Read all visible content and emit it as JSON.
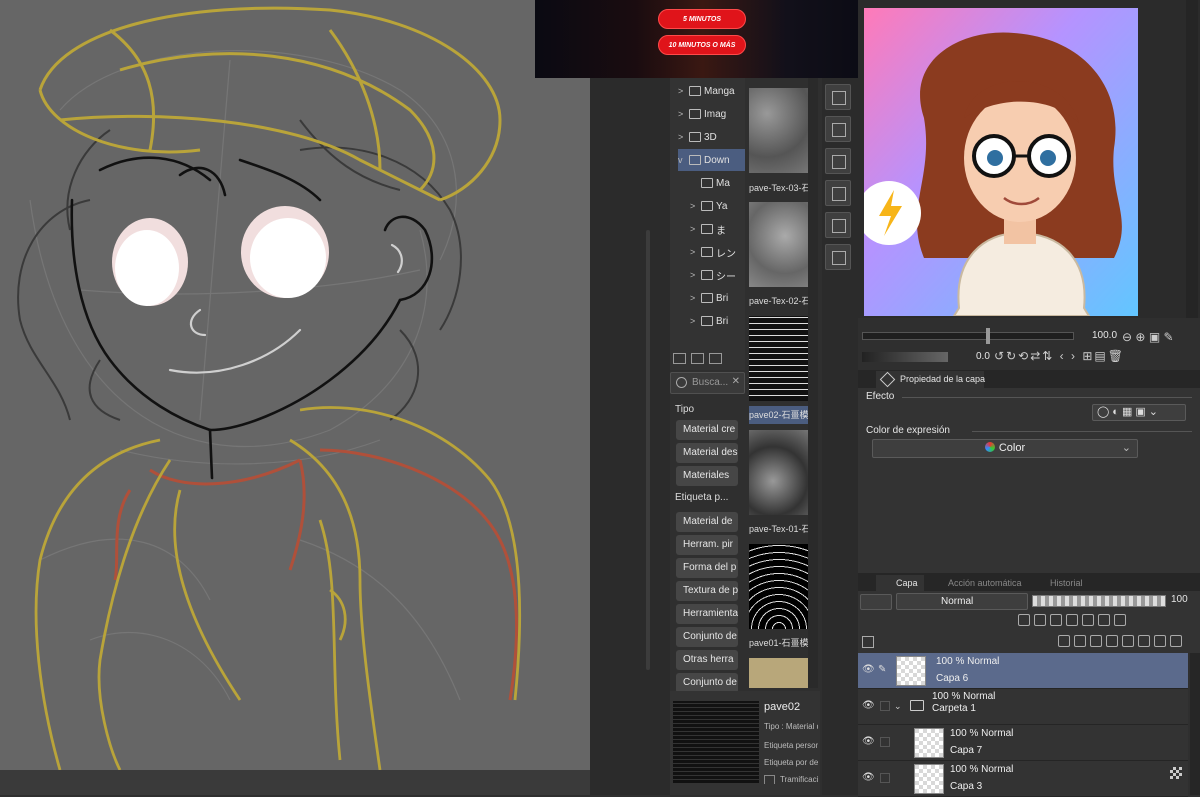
{
  "ad": {
    "buttons": [
      "5 MINUTOS",
      "10 MINUTOS O MÁS"
    ]
  },
  "material_tree": {
    "items": [
      {
        "label": "Manga",
        "expand": ">",
        "selected": false
      },
      {
        "label": "Imag",
        "expand": ">",
        "selected": false
      },
      {
        "label": "3D",
        "expand": ">",
        "selected": false
      },
      {
        "label": "Down",
        "expand": "v",
        "selected": true
      },
      {
        "label": "Ma",
        "expand": "",
        "selected": false
      },
      {
        "label": "Ya",
        "expand": ">",
        "selected": false
      },
      {
        "label": "ま",
        "expand": ">",
        "selected": false
      },
      {
        "label": "レン",
        "expand": ">",
        "selected": false
      },
      {
        "label": "シー",
        "expand": ">",
        "selected": false
      },
      {
        "label": "Bri",
        "expand": ">",
        "selected": false
      },
      {
        "label": "Bri",
        "expand": ">",
        "selected": false
      }
    ]
  },
  "search": {
    "placeholder": "Busca..."
  },
  "tags": {
    "tipo_label": "Tipo",
    "tipo_items": [
      "Material cre",
      "Material des",
      "Materiales"
    ],
    "etiqueta_label": "Etiqueta p...",
    "etiqueta_items": [
      "Material de",
      "Herram. pir",
      "Forma del p",
      "Textura de p",
      "Herramienta",
      "Conjunto de",
      "Otras herra",
      "Conjunto de"
    ]
  },
  "materials": [
    {
      "label": "pave-Tex-03-石",
      "selected": false
    },
    {
      "label": "pave-Tex-02-石",
      "selected": false
    },
    {
      "label": "pave02-石畺模",
      "selected": true
    },
    {
      "label": "pave-Tex-01-石",
      "selected": false
    },
    {
      "label": "pave01-石畺模",
      "selected": false
    }
  ],
  "preview": {
    "name": "pave02",
    "tipo": "Tipo : Material d",
    "etiq_personal": "Etiqueta person",
    "etiq_def": "Etiqueta por def",
    "tramado": "Tramificaci"
  },
  "navigator": {
    "zoom": "100.0",
    "rotation": "0.0"
  },
  "properties": {
    "tab": "Propiedad de la capa",
    "effect_label": "Efecto",
    "expression_label": "Color de expresión",
    "expression_value": "Color"
  },
  "layer_panel": {
    "tabs": [
      "Capa",
      "Acción automática",
      "Historial"
    ],
    "blend_mode": "Normal",
    "opacity": "100",
    "layers": [
      {
        "mode": "100 % Normal",
        "name": "Capa 6",
        "selected": true,
        "indent": 0,
        "folder": false
      },
      {
        "mode": "100 % Normal",
        "name": "Carpeta 1",
        "selected": false,
        "indent": 0,
        "folder": true
      },
      {
        "mode": "100 % Normal",
        "name": "Capa 7",
        "selected": false,
        "indent": 1,
        "folder": false
      },
      {
        "mode": "100 % Normal",
        "name": "Capa 3",
        "selected": false,
        "indent": 1,
        "folder": false
      }
    ]
  },
  "colors": {
    "accent": "#4b5d80",
    "selected_layer": "#5b6a8c",
    "ad_button": "#e0141a",
    "sketch_yellow": "#b9a43a",
    "sketch_red": "#b0503a"
  }
}
